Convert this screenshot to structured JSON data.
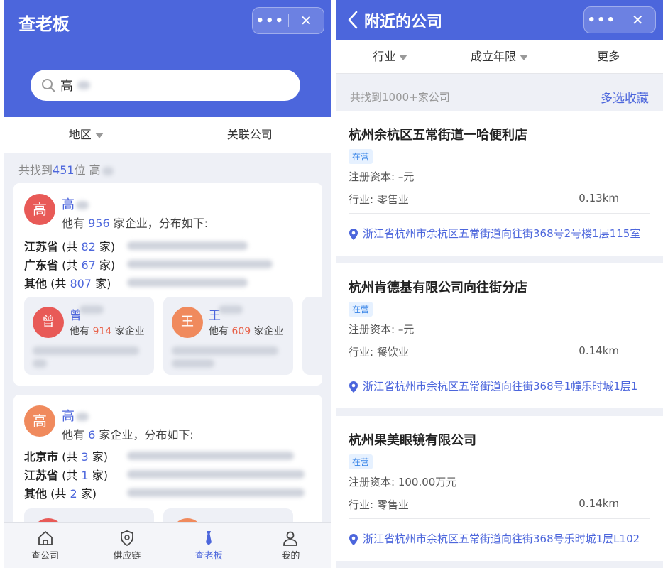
{
  "left": {
    "app_title": "查老板",
    "capsule": {
      "more": "•••",
      "close": "✕"
    },
    "search": {
      "value": "高"
    },
    "filters": [
      {
        "label": "地区",
        "dropdown": true
      },
      {
        "label": "关联公司",
        "dropdown": false
      }
    ],
    "found": {
      "prefix": "共找到",
      "count": "451",
      "suffix": "位 高"
    },
    "cards": [
      {
        "avatar": "高",
        "avatar_color": "#e85a57",
        "name": "高",
        "summary": {
          "prefix": "他有 ",
          "count": "956",
          "suffix": " 家企业，分布如下:"
        },
        "regions": [
          {
            "name": "江苏省",
            "open": " (共 ",
            "count": "82",
            "close": " 家)"
          },
          {
            "name": "广东省",
            "open": " (共 ",
            "count": "67",
            "close": " 家)"
          },
          {
            "name": "其他",
            "open": " (共 ",
            "count": "807",
            "close": " 家)"
          }
        ],
        "associates": [
          {
            "avatar": "曾",
            "color": "#e85a57",
            "name": "曾",
            "prefix": "他有 ",
            "count": "914",
            "suffix": " 家企业"
          },
          {
            "avatar": "王",
            "color": "#f08a5d",
            "name": "王",
            "prefix": "他有 ",
            "count": "609",
            "suffix": " 家企业"
          }
        ]
      },
      {
        "avatar": "高",
        "avatar_color": "#f08a5d",
        "name": "高",
        "summary": {
          "prefix": "他有 ",
          "count": "6",
          "suffix": " 家企业，分布如下:"
        },
        "regions": [
          {
            "name": "北京市",
            "open": " (共 ",
            "count": "3",
            "close": " 家)"
          },
          {
            "name": "江苏省",
            "open": " (共 ",
            "count": "1",
            "close": " 家)"
          },
          {
            "name": "其他",
            "open": " (共 ",
            "count": "2",
            "close": " 家)"
          }
        ]
      }
    ],
    "tabs": [
      {
        "label": "查公司",
        "icon": "home-icon"
      },
      {
        "label": "供应链",
        "icon": "shield-icon"
      },
      {
        "label": "查老板",
        "icon": "tie-icon",
        "active": true
      },
      {
        "label": "我的",
        "icon": "user-icon"
      }
    ]
  },
  "right": {
    "title": "附近的公司",
    "capsule": {
      "more": "•••",
      "close": "✕"
    },
    "filters": [
      {
        "label": "行业",
        "dropdown": true
      },
      {
        "label": "成立年限",
        "dropdown": true
      },
      {
        "label": "更多",
        "dropdown": false
      }
    ],
    "found": "共找到1000+家公司",
    "multi_select": "多选收藏",
    "companies": [
      {
        "name": "杭州余杭区五常街道一哈便利店",
        "status": "在营",
        "capital": "注册资本: –元",
        "industry": "行业: 零售业",
        "distance": "0.13km",
        "address": "浙江省杭州市余杭区五常街道向往街368号2号楼1层115室"
      },
      {
        "name": "杭州肯德基有限公司向往街分店",
        "status": "在营",
        "capital": "注册资本: –元",
        "industry": "行业: 餐饮业",
        "distance": "0.14km",
        "address": "浙江省杭州市余杭区五常街道向往街368号1幢乐时城1层1"
      },
      {
        "name": "杭州果美眼镜有限公司",
        "status": "在营",
        "capital": "注册资本: 100.00万元",
        "industry": "行业: 零售业",
        "distance": "0.14km",
        "address": "浙江省杭州市余杭区五常街道向往街368号乐时城1层L102"
      }
    ]
  },
  "colors": {
    "brand": "#4c66dc",
    "accent_orange": "#e8624a",
    "badge_blue": "#3a86e8"
  }
}
